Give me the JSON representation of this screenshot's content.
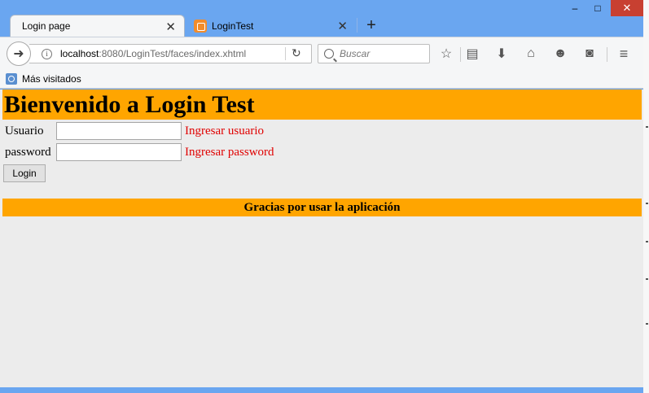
{
  "window": {
    "minimize": "‒",
    "maximize": "□",
    "close": "✕"
  },
  "tabs": [
    {
      "title": "Login page",
      "active": true
    },
    {
      "title": "LoginTest",
      "active": false
    }
  ],
  "toolbar": {
    "url_host": "localhost",
    "url_rest": ":8080/LoginTest/faces/index.xhtml",
    "search_placeholder": "Buscar"
  },
  "bookmarks": {
    "item": "Más visitados"
  },
  "page": {
    "heading": "Bienvenido a Login Test",
    "user_label": "Usuario",
    "user_value": "",
    "user_hint": "Ingresar usuario",
    "password_label": "password",
    "password_value": "",
    "password_hint": "Ingresar password",
    "login_button": "Login",
    "footer": "Gracias por usar la aplicación"
  },
  "colors": {
    "accent": "#ffa500",
    "hint": "#e00000",
    "frame": "#6aa6f0"
  }
}
